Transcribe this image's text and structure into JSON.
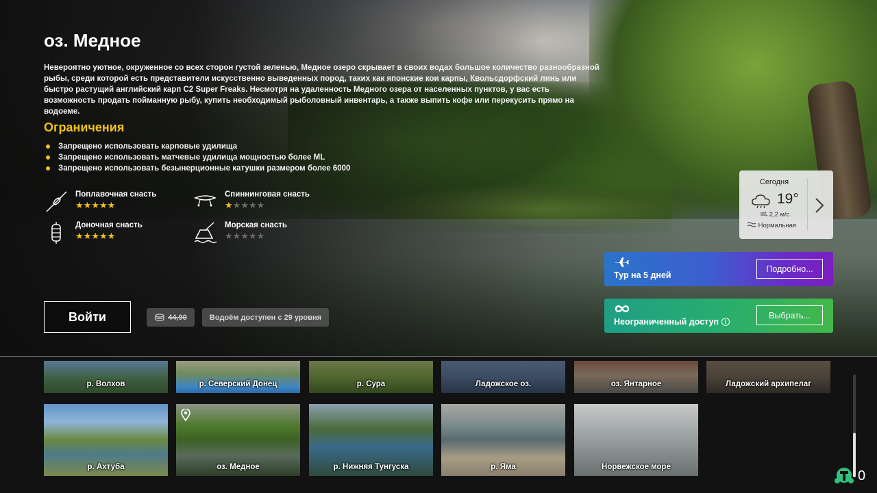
{
  "location": {
    "title": "оз. Медное",
    "description": "Невероятно уютное, окруженное со всех сторон густой зеленью, Медное озеро скрывает в своих водах большое количество разнообразной рыбы, среди которой есть представители искусственно выведенных пород, таких как японские кои карпы, Квольсдорфский линь или быстро растущий английский карп С2 Super Freaks. Несмотря на удаленность Медного озера от населенных пунктов, у вас есть возможность продать пойманную рыбу, купить необходимый рыболовный инвентарь, а также выпить кофе или перекусить прямо на водоеме."
  },
  "restrictions": {
    "title": "Ограничения",
    "items": [
      "Запрещено использовать карповые удилища",
      "Запрещено использовать матчевые удилища мощностью более ML",
      "Запрещено использовать безынерционные катушки размером более 6000"
    ]
  },
  "tackle": [
    {
      "name": "Поплавочная снасть",
      "stars": 5,
      "icon": "float-rod-icon"
    },
    {
      "name": "Спиннинговая снасть",
      "stars": 1,
      "icon": "spinning-lure-icon"
    },
    {
      "name": "Доночная снасть",
      "stars": 5,
      "icon": "bottom-feeder-icon"
    },
    {
      "name": "Морская снасть",
      "stars": 0,
      "icon": "sea-fishing-icon"
    }
  ],
  "actions": {
    "enter_label": "Войти",
    "price_old": "44,90",
    "level_note": "Водоём доступен с 29 уровня"
  },
  "weather": {
    "day": "Сегодня",
    "temp": "19°",
    "wind": "2,2 м/с",
    "pressure": "Нормальная",
    "icon": "cloudy-icon"
  },
  "offers": {
    "tour": {
      "label": "Тур на 5 дней",
      "button": "Подробно...",
      "color_start": "#2a74c9",
      "color_end": "#7a1fc0"
    },
    "unlimited": {
      "label": "Неограниченный доступ",
      "button": "Выбрать...",
      "color_start": "#1f9e86",
      "color_end": "#43b84a"
    }
  },
  "locations_row1": [
    "р. Волхов",
    "р. Северский Донец",
    "р. Сура",
    "Ладожское оз.",
    "оз. Янтарное",
    "Ладожский архипелаг"
  ],
  "locations_row2": [
    "р. Ахтуба",
    "оз. Медное",
    "р. Нижняя Тунгуска",
    "р. Яма",
    "Норвежское море"
  ],
  "selected_location": "оз. Медное",
  "currency": {
    "value": "0",
    "icon": "tortoise-coin-icon",
    "color": "#2ec27e"
  },
  "colors": {
    "accent": "#f1c21b",
    "star_off": "#6a6a6a"
  }
}
